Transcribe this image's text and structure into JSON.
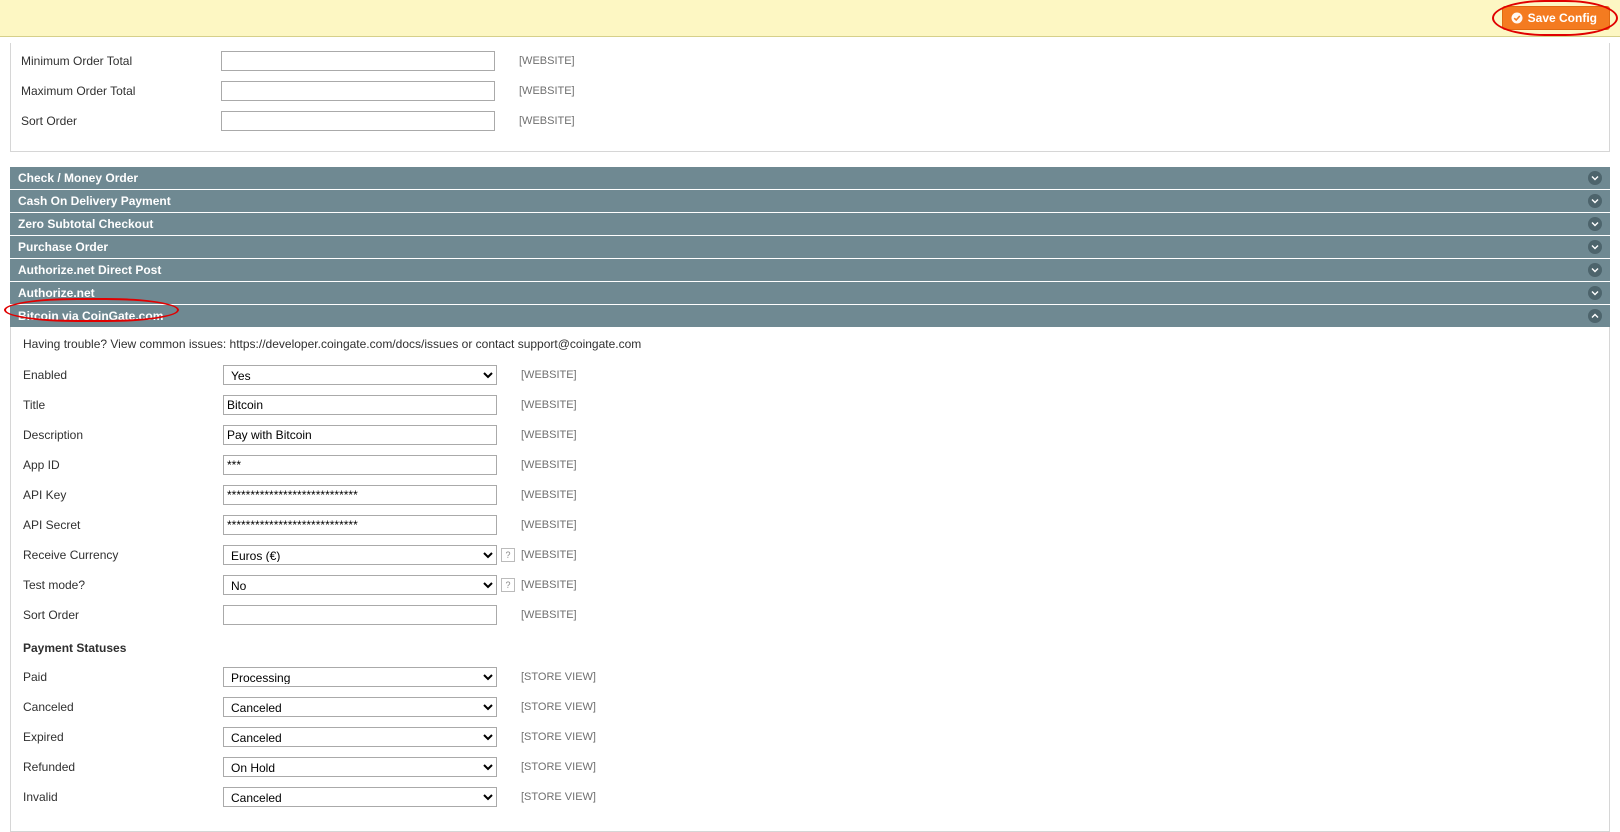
{
  "header": {
    "save_label": "Save Config"
  },
  "scope": {
    "website": "[WEBSITE]",
    "storeview": "[STORE VIEW]"
  },
  "top_fields": {
    "min_order_label": "Minimum Order Total",
    "max_order_label": "Maximum Order Total",
    "sort_order_label": "Sort Order",
    "min_order_value": "",
    "max_order_value": "",
    "sort_order_value": ""
  },
  "sections": {
    "check": "Check / Money Order",
    "cod": "Cash On Delivery Payment",
    "zero": "Zero Subtotal Checkout",
    "po": "Purchase Order",
    "authnet_dp": "Authorize.net Direct Post",
    "authnet": "Authorize.net",
    "bitcoin": "Bitcoin via CoinGate.com"
  },
  "bitcoin": {
    "help_text": "Having trouble? View common issues: https://developer.coingate.com/docs/issues or contact support@coingate.com",
    "fields": {
      "enabled_label": "Enabled",
      "enabled_value": "Yes",
      "title_label": "Title",
      "title_value": "Bitcoin",
      "description_label": "Description",
      "description_value": "Pay with Bitcoin",
      "appid_label": "App ID",
      "appid_value": "***",
      "apikey_label": "API Key",
      "apikey_value": "****************************",
      "apisecret_label": "API Secret",
      "apisecret_value": "****************************",
      "recv_cur_label": "Receive Currency",
      "recv_cur_value": "Euros (€)",
      "test_label": "Test mode?",
      "test_value": "No",
      "sort_label": "Sort Order",
      "sort_value": ""
    },
    "statuses_head": "Payment Statuses",
    "statuses": {
      "paid_label": "Paid",
      "paid_value": "Processing",
      "canceled_label": "Canceled",
      "canceled_value": "Canceled",
      "expired_label": "Expired",
      "expired_value": "Canceled",
      "refunded_label": "Refunded",
      "refunded_value": "On Hold",
      "invalid_label": "Invalid",
      "invalid_value": "Canceled"
    }
  }
}
